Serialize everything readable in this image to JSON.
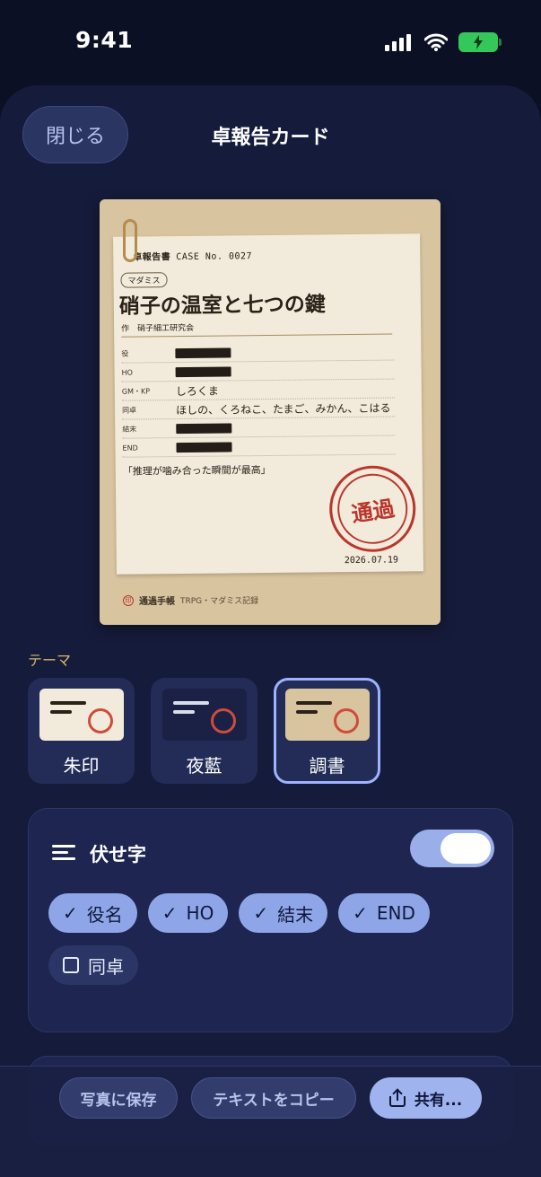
{
  "status": {
    "time": "9:41"
  },
  "header": {
    "close_label": "閉じる",
    "title": "卓報告カード"
  },
  "card": {
    "doc_label": "卓報告書",
    "case_no": "CASE No. 0027",
    "genre": "マダミス",
    "scenario_title": "硝子の温室と七つの鍵",
    "author": "作　硝子細工研究会",
    "rows": [
      {
        "label": "役",
        "value": "",
        "redacted": true
      },
      {
        "label": "HO",
        "value": "",
        "redacted": true
      },
      {
        "label": "GM・KP",
        "value": "しろくま",
        "redacted": false
      },
      {
        "label": "同卓",
        "value": "ほしの、くろねこ、たまご、みかん、こはる",
        "redacted": false
      },
      {
        "label": "結末",
        "value": "",
        "redacted": true
      },
      {
        "label": "END",
        "value": "",
        "redacted": true
      }
    ],
    "quote": "「推理が噛み合った瞬間が最高」",
    "stamp": "通過",
    "date": "2026.07.19",
    "footer_brand": "通過手帳",
    "footer_sub": "TRPG・マダミス記録"
  },
  "theme": {
    "label": "テーマ",
    "options": [
      {
        "name": "朱印",
        "bg": "#f2ebdc",
        "line": "#2a2118",
        "selected": false
      },
      {
        "name": "夜藍",
        "bg": "#1a2145",
        "line": "#d9dcea",
        "selected": false
      },
      {
        "name": "調書",
        "bg": "#d8c49e",
        "line": "#2a2118",
        "selected": true
      }
    ]
  },
  "fuseji": {
    "title": "伏せ字",
    "enabled": true,
    "chips": [
      {
        "label": "役名",
        "checked": true
      },
      {
        "label": "HO",
        "checked": true
      },
      {
        "label": "結末",
        "checked": true
      },
      {
        "label": "END",
        "checked": true
      },
      {
        "label": "同卓",
        "checked": false
      }
    ]
  },
  "actions": {
    "save_photo": "写真に保存",
    "copy_text": "テキストをコピー",
    "share": "共有..."
  }
}
